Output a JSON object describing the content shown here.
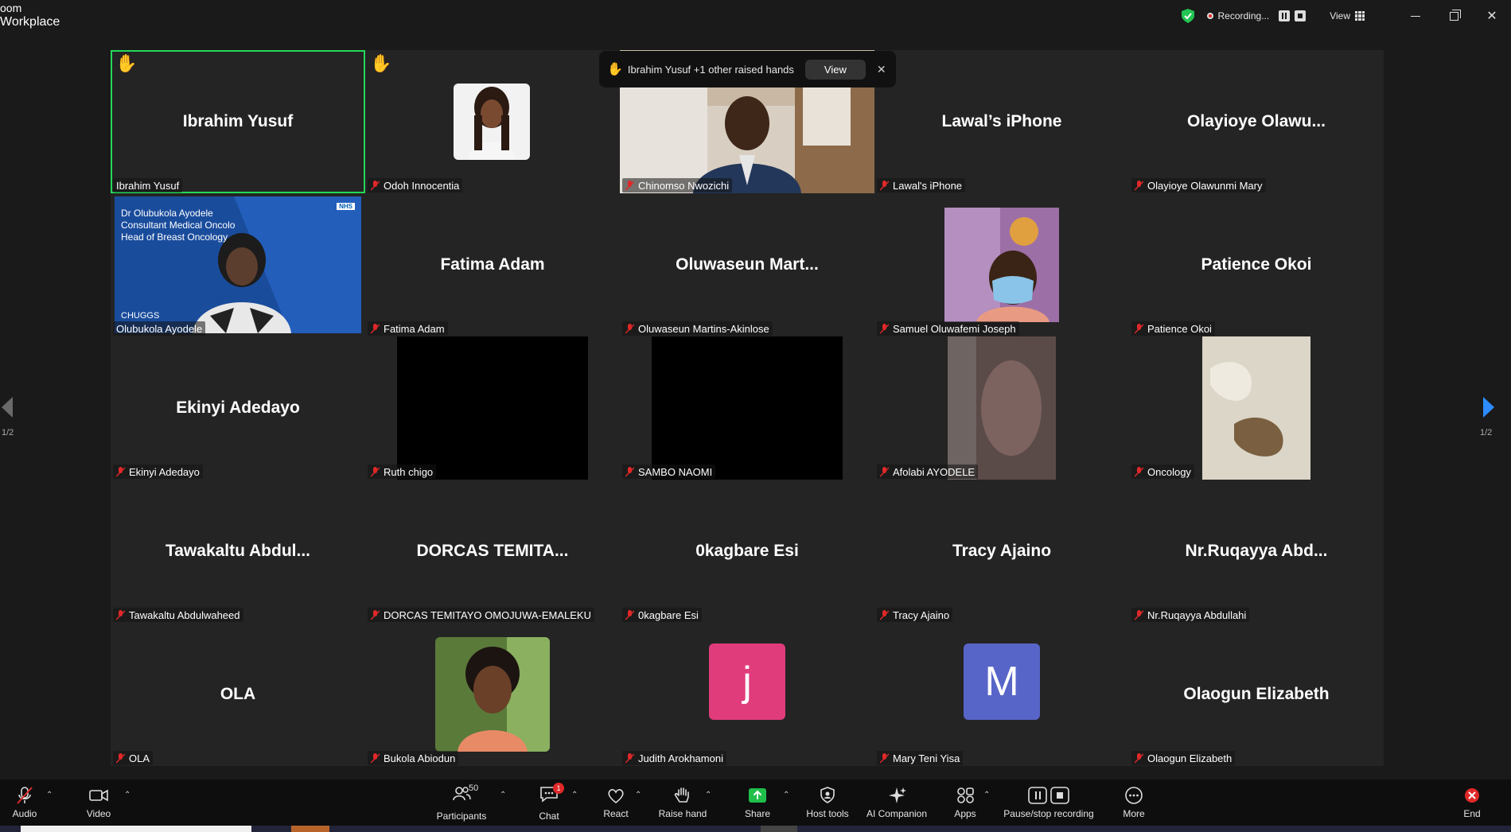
{
  "app": {
    "title_line1": "oom",
    "title_line2": "Workplace"
  },
  "titlebar": {
    "recording_label": "Recording...",
    "view_label": "View"
  },
  "notification": {
    "text": "Ibrahim Yusuf +1 other raised hands",
    "view_button": "View"
  },
  "pager": {
    "left": "1/2",
    "right": "1/2"
  },
  "tiles": [
    {
      "display": "Ibrahim Yusuf",
      "tag": "Ibrahim Yusuf"
    },
    {
      "display": "",
      "tag": "Odoh Innocentia"
    },
    {
      "display": "",
      "tag": "Chinomso Nwozichi"
    },
    {
      "display": "Lawal’s iPhone",
      "tag": "Lawal's iPhone"
    },
    {
      "display": "Olayioye Olawu...",
      "tag": "Olayioye Olawunmi Mary"
    },
    {
      "display": "",
      "tag": "Olubukola Ayodele"
    },
    {
      "display": "Fatima Adam",
      "tag": "Fatima Adam"
    },
    {
      "display": "Oluwaseun Mart...",
      "tag": "Oluwaseun Martins-Akinlose"
    },
    {
      "display": "",
      "tag": "Samuel Oluwafemi Joseph"
    },
    {
      "display": "Patience Okoi",
      "tag": "Patience Okoi"
    },
    {
      "display": "Ekinyi Adedayo",
      "tag": "Ekinyi Adedayo"
    },
    {
      "display": "",
      "tag": "Ruth chigo"
    },
    {
      "display": "",
      "tag": "SAMBO NAOMI"
    },
    {
      "display": "",
      "tag": "Afolabi AYODELE"
    },
    {
      "display": "",
      "tag": "Oncology"
    },
    {
      "display": "Tawakaltu Abdul...",
      "tag": "Tawakaltu Abdulwaheed"
    },
    {
      "display": "DORCAS TEMITA...",
      "tag": "DORCAS TEMITAYO OMOJUWA-EMALEKU"
    },
    {
      "display": "0kagbare Esi",
      "tag": "0kagbare Esi"
    },
    {
      "display": "Tracy Ajaino",
      "tag": "Tracy Ajaino"
    },
    {
      "display": "Nr.Ruqayya Abd...",
      "tag": "Nr.Ruqayya Abdullahi"
    },
    {
      "display": "OLA",
      "tag": "OLA"
    },
    {
      "display": "",
      "tag": "Bukola Abiodun"
    },
    {
      "display": "",
      "tag": "Judith Arokhamoni",
      "letter": "j",
      "color": "#e03c7b"
    },
    {
      "display": "",
      "tag": "Mary Teni Yisa",
      "letter": "M",
      "color": "#5865c8"
    },
    {
      "display": "Olaogun Elizabeth",
      "tag": "Olaogun Elizabeth"
    }
  ],
  "slide": {
    "line1": "Dr Olubukola Ayodele",
    "line2": "Consultant Medical Oncolo",
    "line3": "Head of Breast Oncology",
    "corner": "CHUGGS",
    "logo": "NHS"
  },
  "toolbar": {
    "audio": "Audio",
    "video": "Video",
    "participants": "Participants",
    "participants_count": "50",
    "chat": "Chat",
    "chat_badge": "1",
    "react": "React",
    "raise_hand": "Raise hand",
    "share": "Share",
    "host_tools": "Host tools",
    "ai_companion": "AI Companion",
    "apps": "Apps",
    "pause_stop": "Pause/stop recording",
    "more": "More",
    "end": "End"
  },
  "colors": {
    "accent_green": "#23d959",
    "hand_yellow": "#f5b81c",
    "mute_red": "#e02828",
    "share_green": "#1fbf4a"
  }
}
